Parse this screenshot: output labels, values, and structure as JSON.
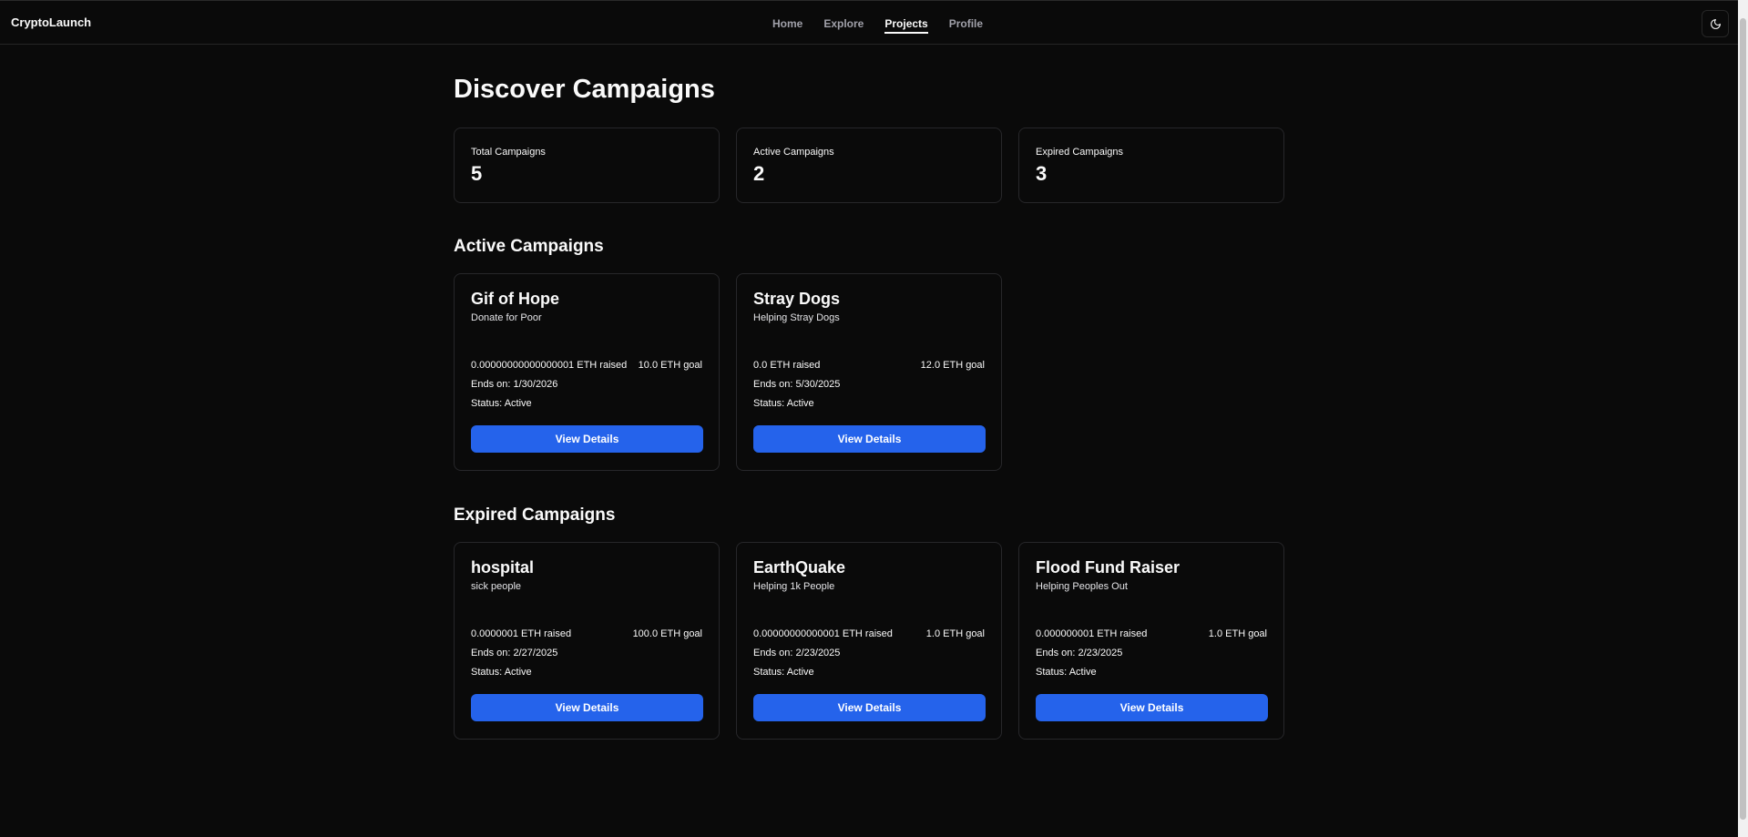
{
  "brand": "CryptoLaunch",
  "nav": {
    "items": [
      {
        "label": "Home",
        "active": false
      },
      {
        "label": "Explore",
        "active": false
      },
      {
        "label": "Projects",
        "active": true
      },
      {
        "label": "Profile",
        "active": false
      }
    ]
  },
  "theme_toggle": {
    "icon": "moon-icon"
  },
  "page_title": "Discover Campaigns",
  "stats": [
    {
      "label": "Total Campaigns",
      "value": "5"
    },
    {
      "label": "Active Campaigns",
      "value": "2"
    },
    {
      "label": "Expired Campaigns",
      "value": "3"
    }
  ],
  "active_section": {
    "title": "Active Campaigns",
    "campaigns": [
      {
        "title": "Gif of Hope",
        "description": "Donate for Poor",
        "raised": "0.00000000000000001 ETH raised",
        "goal": "10.0 ETH goal",
        "ends": "Ends on: 1/30/2026",
        "status": "Status: Active",
        "button": "View Details"
      },
      {
        "title": "Stray Dogs",
        "description": "Helping Stray Dogs",
        "raised": "0.0 ETH raised",
        "goal": "12.0 ETH goal",
        "ends": "Ends on: 5/30/2025",
        "status": "Status: Active",
        "button": "View Details"
      }
    ]
  },
  "expired_section": {
    "title": "Expired Campaigns",
    "campaigns": [
      {
        "title": "hospital",
        "description": "sick people",
        "raised": "0.0000001 ETH raised",
        "goal": "100.0 ETH goal",
        "ends": "Ends on: 2/27/2025",
        "status": "Status: Active",
        "button": "View Details"
      },
      {
        "title": "EarthQuake",
        "description": "Helping 1k People",
        "raised": "0.00000000000001 ETH raised",
        "goal": "1.0 ETH goal",
        "ends": "Ends on: 2/23/2025",
        "status": "Status: Active",
        "button": "View Details"
      },
      {
        "title": "Flood Fund Raiser",
        "description": "Helping Peoples Out",
        "raised": "0.000000001 ETH raised",
        "goal": "1.0 ETH goal",
        "ends": "Ends on: 2/23/2025",
        "status": "Status: Active",
        "button": "View Details"
      }
    ]
  },
  "colors": {
    "background": "#0a0a0a",
    "accent": "#2563eb",
    "border": "#27272a"
  }
}
